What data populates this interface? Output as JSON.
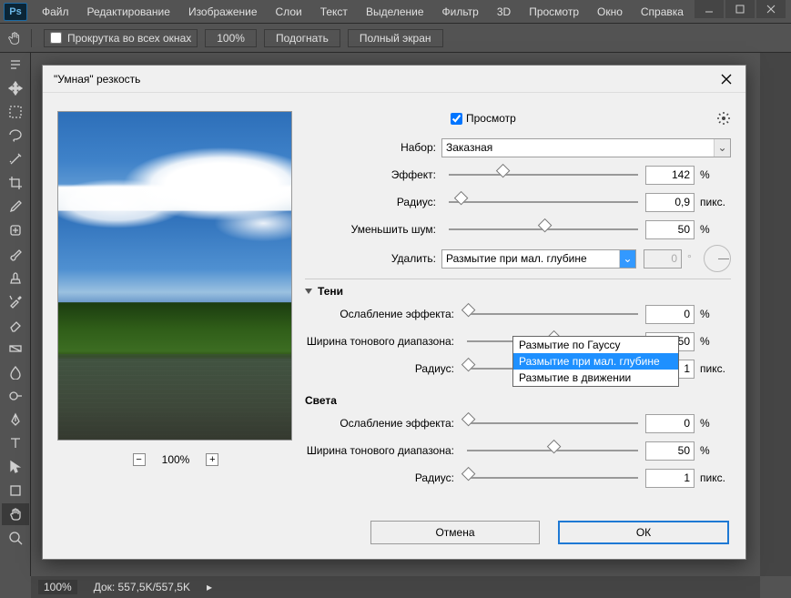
{
  "app": {
    "logo": "Ps"
  },
  "menu": [
    "Файл",
    "Редактирование",
    "Изображение",
    "Слои",
    "Текст",
    "Выделение",
    "Фильтр",
    "3D",
    "Просмотр",
    "Окно",
    "Справка"
  ],
  "options": {
    "scroll_all_label": "Прокрутка во всех окнах",
    "zoom100": "100%",
    "fit": "Подогнать",
    "fullscreen": "Полный экран"
  },
  "status": {
    "zoom": "100%",
    "doc_label": "Док: 557,5K/557,5K"
  },
  "dialog": {
    "title": "\"Умная\" резкость",
    "preview_label": "Просмотр",
    "set_label": "Набор:",
    "set_value": "Заказная",
    "amount_label": "Эффект:",
    "amount_value": "142",
    "amount_unit": "%",
    "radius_label": "Радиус:",
    "radius_value": "0,9",
    "radius_unit": "пикс.",
    "noise_label": "Уменьшить шум:",
    "noise_value": "50",
    "noise_unit": "%",
    "remove_label": "Удалить:",
    "remove_value": "Размытие при мал. глубине",
    "remove_options": [
      "Размытие по Гауссу",
      "Размытие при мал. глубине",
      "Размытие в движении"
    ],
    "angle_value": "0",
    "angle_unit": "°",
    "shadows_hdr": "Тени",
    "highlights_hdr": "Света",
    "fade_label": "Ослабление эффекта:",
    "tonal_label": "Ширина тонового диапазона:",
    "radius2_label": "Радиус:",
    "shadows": {
      "fade": "0",
      "tonal": "50",
      "radius": "1"
    },
    "highlights": {
      "fade": "0",
      "tonal": "50",
      "radius": "1"
    },
    "pct": "%",
    "px": "пикс.",
    "zoom_value": "100%",
    "cancel": "Отмена",
    "ok": "ОК"
  }
}
